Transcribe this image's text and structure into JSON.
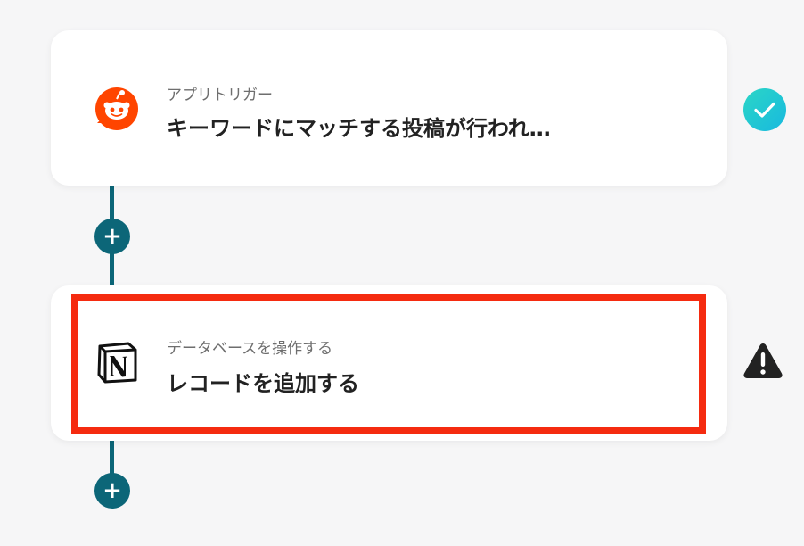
{
  "steps": [
    {
      "subtitle": "アプリトリガー",
      "title": "キーワードにマッチする投稿が行われ…",
      "icon": "reddit-icon",
      "status": "success-check-icon"
    },
    {
      "subtitle": "データベースを操作する",
      "title": "レコードを追加する",
      "icon": "notion-icon",
      "status": "warning-icon"
    }
  ],
  "add_button_glyph": "+",
  "colors": {
    "background": "#f6f6f7",
    "card": "#ffffff",
    "connector": "#0c6678",
    "highlight": "#f52b10",
    "reddit": "#ff4500",
    "success_start": "#2bd6c6",
    "success_end": "#18b9df",
    "warning": "#222222"
  }
}
